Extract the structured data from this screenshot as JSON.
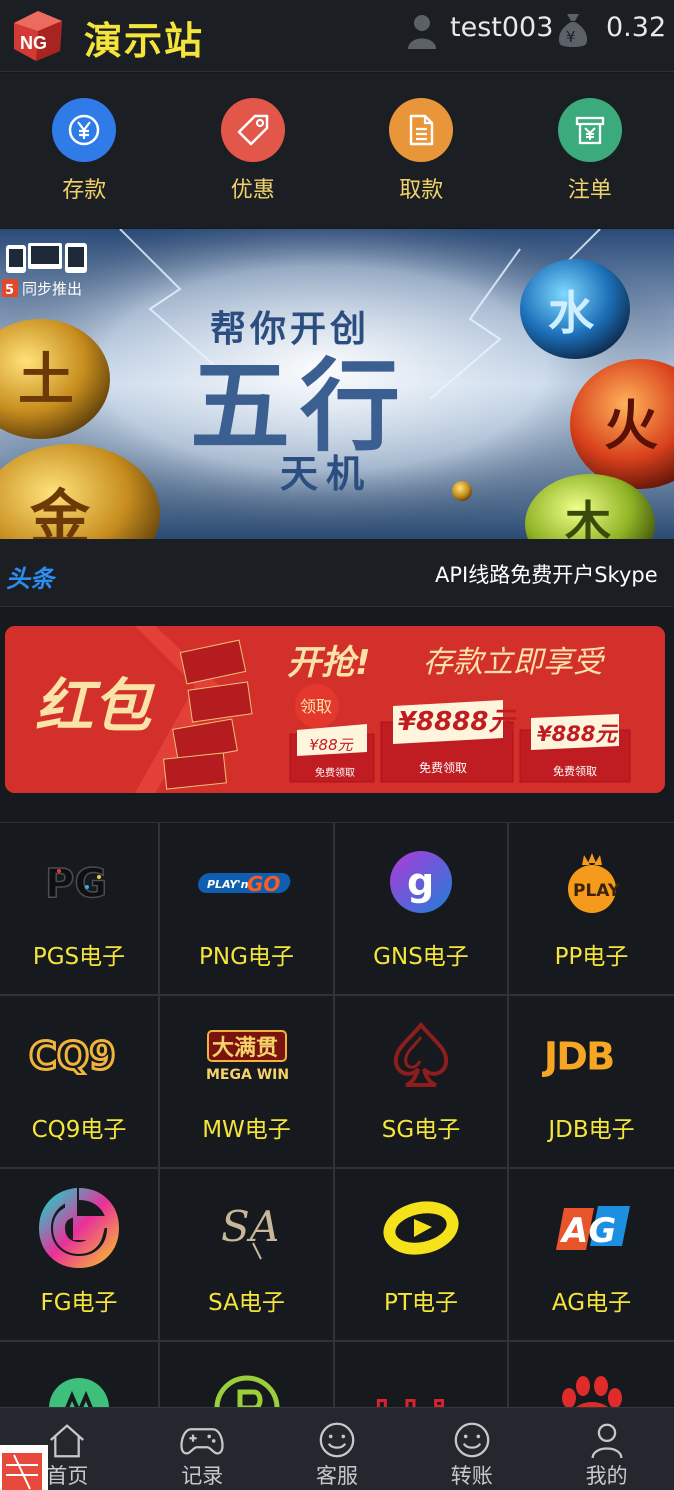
{
  "header": {
    "logo_text": "NG",
    "title": "演示站",
    "username": "test003",
    "balance": "0.32"
  },
  "actions": [
    {
      "label": "存款",
      "icon": "yen-circle-icon",
      "color": "#2f7be8"
    },
    {
      "label": "优惠",
      "icon": "tag-icon",
      "color": "#e3574b"
    },
    {
      "label": "取款",
      "icon": "document-icon",
      "color": "#e9963b"
    },
    {
      "label": "注单",
      "icon": "receipt-icon",
      "color": "#3bab7c"
    }
  ],
  "banner": {
    "badge": "同步推出",
    "line1": "帮你开创",
    "line2": "五行",
    "line3": "天机",
    "element_left_top": "土",
    "element_left_bottom": "金",
    "element_right_top": "水",
    "element_right_middle": "火",
    "element_right_bottom": "木"
  },
  "ticker": {
    "tag": "头条",
    "text": "API线路免费开户Skype"
  },
  "promo": {
    "title": "红包",
    "headline": "开抢!",
    "subline": "存款立即享受",
    "claim_badge": "领取",
    "envelopes": [
      {
        "amount": "¥88元",
        "note": "免费领取"
      },
      {
        "amount": "¥8888元",
        "note": "免费领取"
      },
      {
        "amount": "¥888元",
        "note": "免费领取"
      }
    ]
  },
  "games": [
    {
      "name": "PGS电子",
      "logo": "PG"
    },
    {
      "name": "PNG电子",
      "logo": "PLAY'n GO"
    },
    {
      "name": "GNS电子",
      "logo": "g"
    },
    {
      "name": "PP电子",
      "logo": "PLAY"
    },
    {
      "name": "CQ9电子",
      "logo": "CQ9"
    },
    {
      "name": "MW电子",
      "logo": "MEGA WIN",
      "logo_cn": "大满贯"
    },
    {
      "name": "SG电子",
      "logo": "spade"
    },
    {
      "name": "JDB电子",
      "logo": "JDB"
    },
    {
      "name": "FG电子",
      "logo": "G"
    },
    {
      "name": "SA电子",
      "logo": "SA"
    },
    {
      "name": "PT电子",
      "logo": "PT"
    },
    {
      "name": "AG电子",
      "logo": "AG"
    },
    {
      "name": "",
      "logo": "leaf"
    },
    {
      "name": "",
      "logo": "P"
    },
    {
      "name": "",
      "logo": "bbin"
    },
    {
      "name": "",
      "logo": "paw"
    }
  ],
  "bottom_nav": [
    {
      "label": "首页",
      "icon": "home-icon"
    },
    {
      "label": "记录",
      "icon": "gamepad-icon"
    },
    {
      "label": "客服",
      "icon": "smile-icon"
    },
    {
      "label": "转账",
      "icon": "smile-icon"
    },
    {
      "label": "我的",
      "icon": "user-icon"
    }
  ]
}
